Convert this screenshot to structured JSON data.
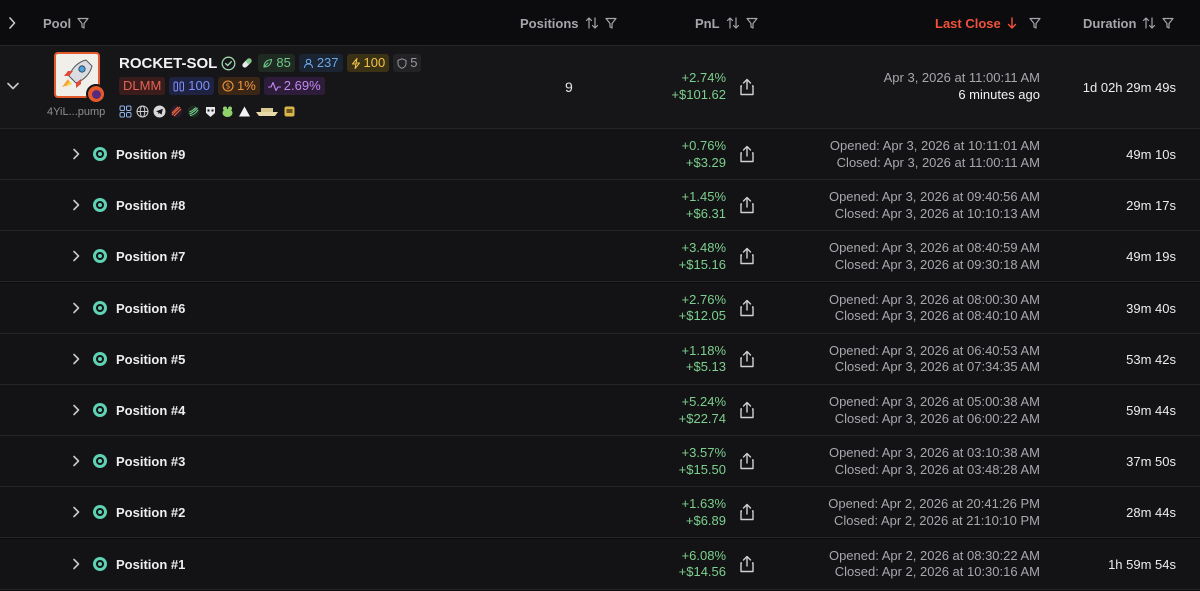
{
  "header": {
    "pool_label": "Pool",
    "positions_label": "Positions",
    "pnl_label": "PnL",
    "last_close_label": "Last Close",
    "duration_label": "Duration"
  },
  "pool": {
    "name": "ROCKET-SOL",
    "address_short": "4YiL...pump",
    "badges": {
      "leaf_value": "85",
      "users_value": "237",
      "bolt_value": "100",
      "shield_value": "5",
      "type_label": "DLMM",
      "bin_value": "100",
      "fee_value": "1%",
      "volatility_value": "2.69%"
    },
    "positions_count": "9",
    "pnl_percent": "+2.74%",
    "pnl_usd": "+$101.62",
    "last_close_date": "Apr 3, 2026 at 11:00:11 AM",
    "last_close_relative": "6 minutes ago",
    "duration": "1d 02h 29m 49s"
  },
  "positions": [
    {
      "label": "Position #9",
      "pnl_percent": "+0.76%",
      "pnl_usd": "+$3.29",
      "opened": "Opened: Apr 3, 2026 at 10:11:01 AM",
      "closed": "Closed: Apr 3, 2026 at 11:00:11 AM",
      "duration": "49m 10s"
    },
    {
      "label": "Position #8",
      "pnl_percent": "+1.45%",
      "pnl_usd": "+$6.31",
      "opened": "Opened: Apr 3, 2026 at 09:40:56 AM",
      "closed": "Closed: Apr 3, 2026 at 10:10:13 AM",
      "duration": "29m 17s"
    },
    {
      "label": "Position #7",
      "pnl_percent": "+3.48%",
      "pnl_usd": "+$15.16",
      "opened": "Opened: Apr 3, 2026 at 08:40:59 AM",
      "closed": "Closed: Apr 3, 2026 at 09:30:18 AM",
      "duration": "49m 19s"
    },
    {
      "label": "Position #6",
      "pnl_percent": "+2.76%",
      "pnl_usd": "+$12.05",
      "opened": "Opened: Apr 3, 2026 at 08:00:30 AM",
      "closed": "Closed: Apr 3, 2026 at 08:40:10 AM",
      "duration": "39m 40s"
    },
    {
      "label": "Position #5",
      "pnl_percent": "+1.18%",
      "pnl_usd": "+$5.13",
      "opened": "Opened: Apr 3, 2026 at 06:40:53 AM",
      "closed": "Closed: Apr 3, 2026 at 07:34:35 AM",
      "duration": "53m 42s"
    },
    {
      "label": "Position #4",
      "pnl_percent": "+5.24%",
      "pnl_usd": "+$22.74",
      "opened": "Opened: Apr 3, 2026 at 05:00:38 AM",
      "closed": "Closed: Apr 3, 2026 at 06:00:22 AM",
      "duration": "59m 44s"
    },
    {
      "label": "Position #3",
      "pnl_percent": "+3.57%",
      "pnl_usd": "+$15.50",
      "opened": "Opened: Apr 3, 2026 at 03:10:38 AM",
      "closed": "Closed: Apr 3, 2026 at 03:48:28 AM",
      "duration": "37m 50s"
    },
    {
      "label": "Position #2",
      "pnl_percent": "+1.63%",
      "pnl_usd": "+$6.89",
      "opened": "Opened: Apr 2, 2026 at 20:41:26 PM",
      "closed": "Closed: Apr 2, 2026 at 21:10:10 PM",
      "duration": "28m 44s"
    },
    {
      "label": "Position #1",
      "pnl_percent": "+6.08%",
      "pnl_usd": "+$14.56",
      "opened": "Opened: Apr 2, 2026 at 08:30:22 AM",
      "closed": "Closed: Apr 2, 2026 at 10:30:16 AM",
      "duration": "1h 59m 54s"
    }
  ],
  "colors": {
    "positive": "#7ccf8e",
    "accent": "#f0523b",
    "background": "#0c0c0e"
  }
}
